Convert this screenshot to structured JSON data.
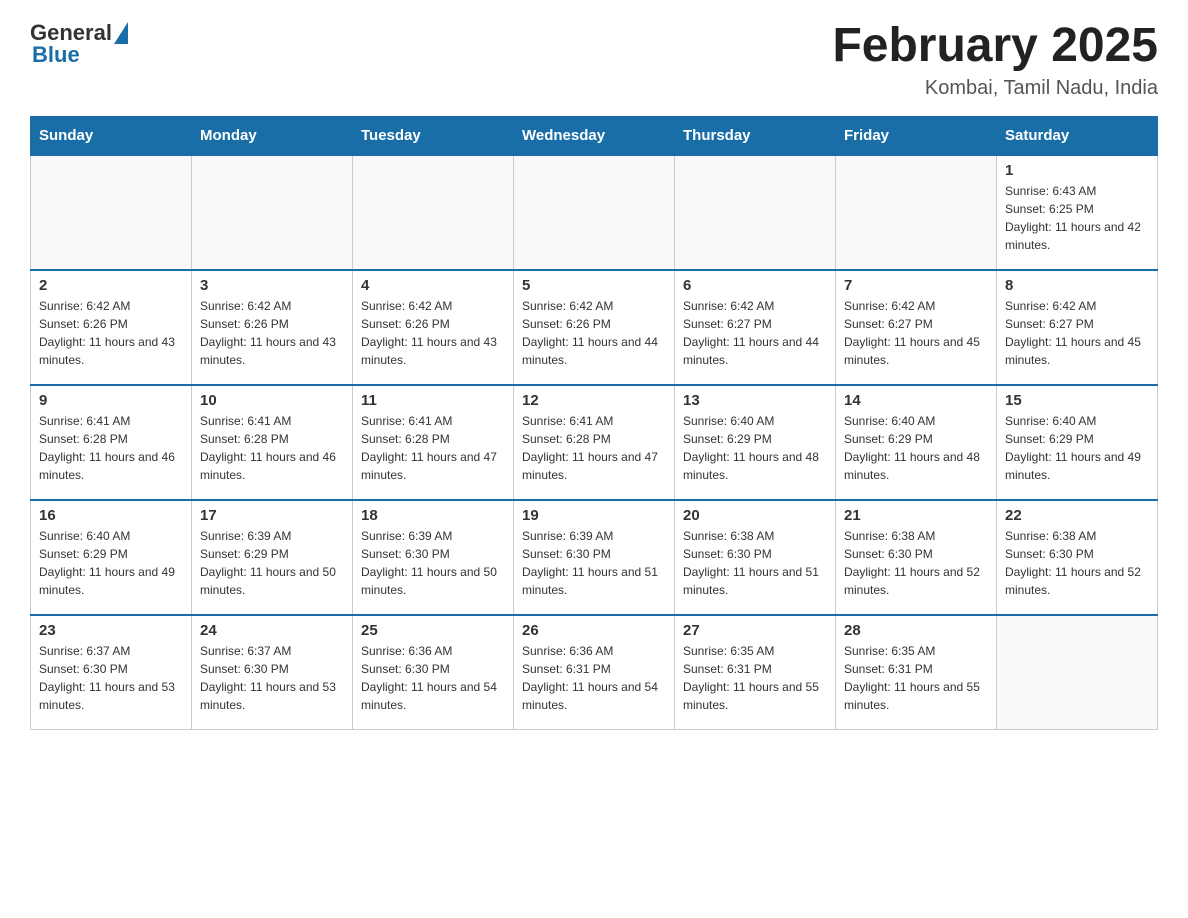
{
  "header": {
    "logo": {
      "general": "General",
      "blue": "Blue"
    },
    "title": "February 2025",
    "location": "Kombai, Tamil Nadu, India"
  },
  "days_of_week": [
    "Sunday",
    "Monday",
    "Tuesday",
    "Wednesday",
    "Thursday",
    "Friday",
    "Saturday"
  ],
  "weeks": [
    [
      {
        "day": "",
        "info": ""
      },
      {
        "day": "",
        "info": ""
      },
      {
        "day": "",
        "info": ""
      },
      {
        "day": "",
        "info": ""
      },
      {
        "day": "",
        "info": ""
      },
      {
        "day": "",
        "info": ""
      },
      {
        "day": "1",
        "info": "Sunrise: 6:43 AM\nSunset: 6:25 PM\nDaylight: 11 hours and 42 minutes."
      }
    ],
    [
      {
        "day": "2",
        "info": "Sunrise: 6:42 AM\nSunset: 6:26 PM\nDaylight: 11 hours and 43 minutes."
      },
      {
        "day": "3",
        "info": "Sunrise: 6:42 AM\nSunset: 6:26 PM\nDaylight: 11 hours and 43 minutes."
      },
      {
        "day": "4",
        "info": "Sunrise: 6:42 AM\nSunset: 6:26 PM\nDaylight: 11 hours and 43 minutes."
      },
      {
        "day": "5",
        "info": "Sunrise: 6:42 AM\nSunset: 6:26 PM\nDaylight: 11 hours and 44 minutes."
      },
      {
        "day": "6",
        "info": "Sunrise: 6:42 AM\nSunset: 6:27 PM\nDaylight: 11 hours and 44 minutes."
      },
      {
        "day": "7",
        "info": "Sunrise: 6:42 AM\nSunset: 6:27 PM\nDaylight: 11 hours and 45 minutes."
      },
      {
        "day": "8",
        "info": "Sunrise: 6:42 AM\nSunset: 6:27 PM\nDaylight: 11 hours and 45 minutes."
      }
    ],
    [
      {
        "day": "9",
        "info": "Sunrise: 6:41 AM\nSunset: 6:28 PM\nDaylight: 11 hours and 46 minutes."
      },
      {
        "day": "10",
        "info": "Sunrise: 6:41 AM\nSunset: 6:28 PM\nDaylight: 11 hours and 46 minutes."
      },
      {
        "day": "11",
        "info": "Sunrise: 6:41 AM\nSunset: 6:28 PM\nDaylight: 11 hours and 47 minutes."
      },
      {
        "day": "12",
        "info": "Sunrise: 6:41 AM\nSunset: 6:28 PM\nDaylight: 11 hours and 47 minutes."
      },
      {
        "day": "13",
        "info": "Sunrise: 6:40 AM\nSunset: 6:29 PM\nDaylight: 11 hours and 48 minutes."
      },
      {
        "day": "14",
        "info": "Sunrise: 6:40 AM\nSunset: 6:29 PM\nDaylight: 11 hours and 48 minutes."
      },
      {
        "day": "15",
        "info": "Sunrise: 6:40 AM\nSunset: 6:29 PM\nDaylight: 11 hours and 49 minutes."
      }
    ],
    [
      {
        "day": "16",
        "info": "Sunrise: 6:40 AM\nSunset: 6:29 PM\nDaylight: 11 hours and 49 minutes."
      },
      {
        "day": "17",
        "info": "Sunrise: 6:39 AM\nSunset: 6:29 PM\nDaylight: 11 hours and 50 minutes."
      },
      {
        "day": "18",
        "info": "Sunrise: 6:39 AM\nSunset: 6:30 PM\nDaylight: 11 hours and 50 minutes."
      },
      {
        "day": "19",
        "info": "Sunrise: 6:39 AM\nSunset: 6:30 PM\nDaylight: 11 hours and 51 minutes."
      },
      {
        "day": "20",
        "info": "Sunrise: 6:38 AM\nSunset: 6:30 PM\nDaylight: 11 hours and 51 minutes."
      },
      {
        "day": "21",
        "info": "Sunrise: 6:38 AM\nSunset: 6:30 PM\nDaylight: 11 hours and 52 minutes."
      },
      {
        "day": "22",
        "info": "Sunrise: 6:38 AM\nSunset: 6:30 PM\nDaylight: 11 hours and 52 minutes."
      }
    ],
    [
      {
        "day": "23",
        "info": "Sunrise: 6:37 AM\nSunset: 6:30 PM\nDaylight: 11 hours and 53 minutes."
      },
      {
        "day": "24",
        "info": "Sunrise: 6:37 AM\nSunset: 6:30 PM\nDaylight: 11 hours and 53 minutes."
      },
      {
        "day": "25",
        "info": "Sunrise: 6:36 AM\nSunset: 6:30 PM\nDaylight: 11 hours and 54 minutes."
      },
      {
        "day": "26",
        "info": "Sunrise: 6:36 AM\nSunset: 6:31 PM\nDaylight: 11 hours and 54 minutes."
      },
      {
        "day": "27",
        "info": "Sunrise: 6:35 AM\nSunset: 6:31 PM\nDaylight: 11 hours and 55 minutes."
      },
      {
        "day": "28",
        "info": "Sunrise: 6:35 AM\nSunset: 6:31 PM\nDaylight: 11 hours and 55 minutes."
      },
      {
        "day": "",
        "info": ""
      }
    ]
  ]
}
